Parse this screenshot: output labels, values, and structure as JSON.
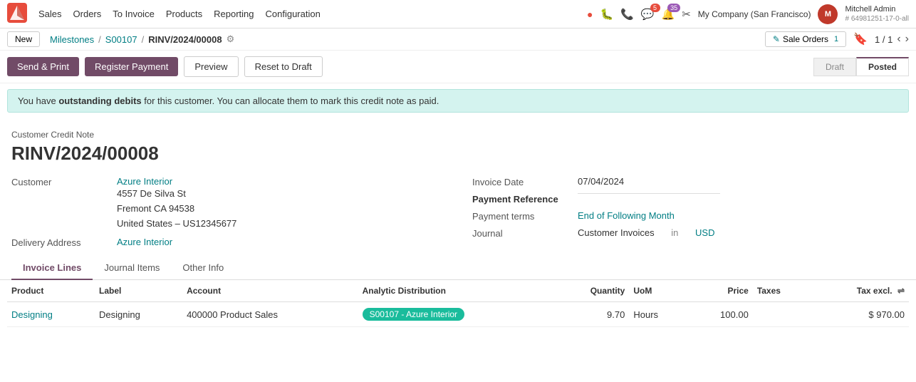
{
  "topnav": {
    "menu_items": [
      "Sales",
      "Orders",
      "To Invoice",
      "Products",
      "Reporting",
      "Configuration"
    ],
    "company": "My Company (San Francisco)",
    "user_name": "Mitchell Admin",
    "user_id": "# 64981251-17-0-all",
    "notif_badges": {
      "messages": "5",
      "activities": "35"
    },
    "icons": {
      "dot": "●",
      "bug": "🐞",
      "phone": "📞",
      "chat": "💬",
      "activity": "🔔",
      "scissors": "✂",
      "bookmark": "🔖"
    }
  },
  "breadcrumb": {
    "new_label": "New",
    "parent": "Milestones",
    "separator": "/",
    "sibling": "S00107",
    "current": "RINV/2024/00008",
    "sale_orders_label": "Sale Orders",
    "sale_orders_count": "1",
    "pagination": "1 / 1"
  },
  "actions": {
    "send_print": "Send & Print",
    "register_payment": "Register Payment",
    "preview": "Preview",
    "reset_draft": "Reset to Draft",
    "status_draft": "Draft",
    "status_posted": "Posted"
  },
  "alert": {
    "text_before": "You have ",
    "bold_text": "outstanding debits",
    "text_after": " for this customer. You can allocate them to mark this credit note as paid."
  },
  "form": {
    "doc_type": "Customer Credit Note",
    "doc_number": "RINV/2024/00008",
    "customer_label": "Customer",
    "customer_name": "Azure Interior",
    "customer_address_line1": "4557 De Silva St",
    "customer_address_line2": "Fremont CA 94538",
    "customer_address_line3": "United States – US12345677",
    "delivery_address_label": "Delivery Address",
    "delivery_address": "Azure Interior",
    "invoice_date_label": "Invoice Date",
    "invoice_date": "07/04/2024",
    "payment_ref_label": "Payment Reference",
    "payment_ref_value": "",
    "payment_terms_label": "Payment terms",
    "payment_terms": "End of Following Month",
    "journal_label": "Journal",
    "journal_value": "Customer Invoices",
    "journal_in": "in",
    "journal_currency": "USD"
  },
  "tabs": [
    {
      "id": "invoice-lines",
      "label": "Invoice Lines",
      "active": true
    },
    {
      "id": "journal-items",
      "label": "Journal Items",
      "active": false
    },
    {
      "id": "other-info",
      "label": "Other Info",
      "active": false
    }
  ],
  "table": {
    "columns": [
      {
        "id": "product",
        "label": "Product"
      },
      {
        "id": "label",
        "label": "Label"
      },
      {
        "id": "account",
        "label": "Account"
      },
      {
        "id": "analytic",
        "label": "Analytic Distribution"
      },
      {
        "id": "quantity",
        "label": "Quantity"
      },
      {
        "id": "uom",
        "label": "UoM"
      },
      {
        "id": "price",
        "label": "Price"
      },
      {
        "id": "taxes",
        "label": "Taxes"
      },
      {
        "id": "tax_excl",
        "label": "Tax excl."
      }
    ],
    "rows": [
      {
        "product": "Designing",
        "product_link": true,
        "label": "Designing",
        "account": "400000 Product Sales",
        "analytic": "S00107 - Azure Interior",
        "quantity": "9.70",
        "uom": "Hours",
        "price": "100.00",
        "taxes": "",
        "tax_excl": "$ 970.00"
      }
    ]
  }
}
